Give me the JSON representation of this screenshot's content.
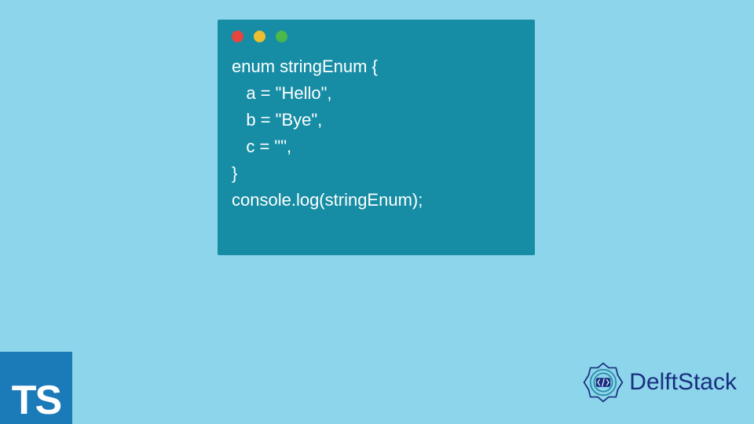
{
  "code": {
    "lines": [
      "enum stringEnum {",
      "   a = \"Hello\",",
      "   b = \"Bye\",",
      "   c = \"\",",
      "}",
      "console.log(stringEnum);"
    ],
    "joined": "enum stringEnum {\n   a = \"Hello\",\n   b = \"Bye\",\n   c = \"\",\n}\nconsole.log(stringEnum);"
  },
  "ts_logo": {
    "label": "TS"
  },
  "delftstack": {
    "label": "DelftStack"
  },
  "colors": {
    "background": "#8cd5ea",
    "code_window": "#168da5",
    "dot_red": "#e8443e",
    "dot_yellow": "#ecbf30",
    "dot_green": "#4bb849",
    "ts_logo_bg": "#1b7ab8",
    "brand_text": "#1a2f80"
  }
}
